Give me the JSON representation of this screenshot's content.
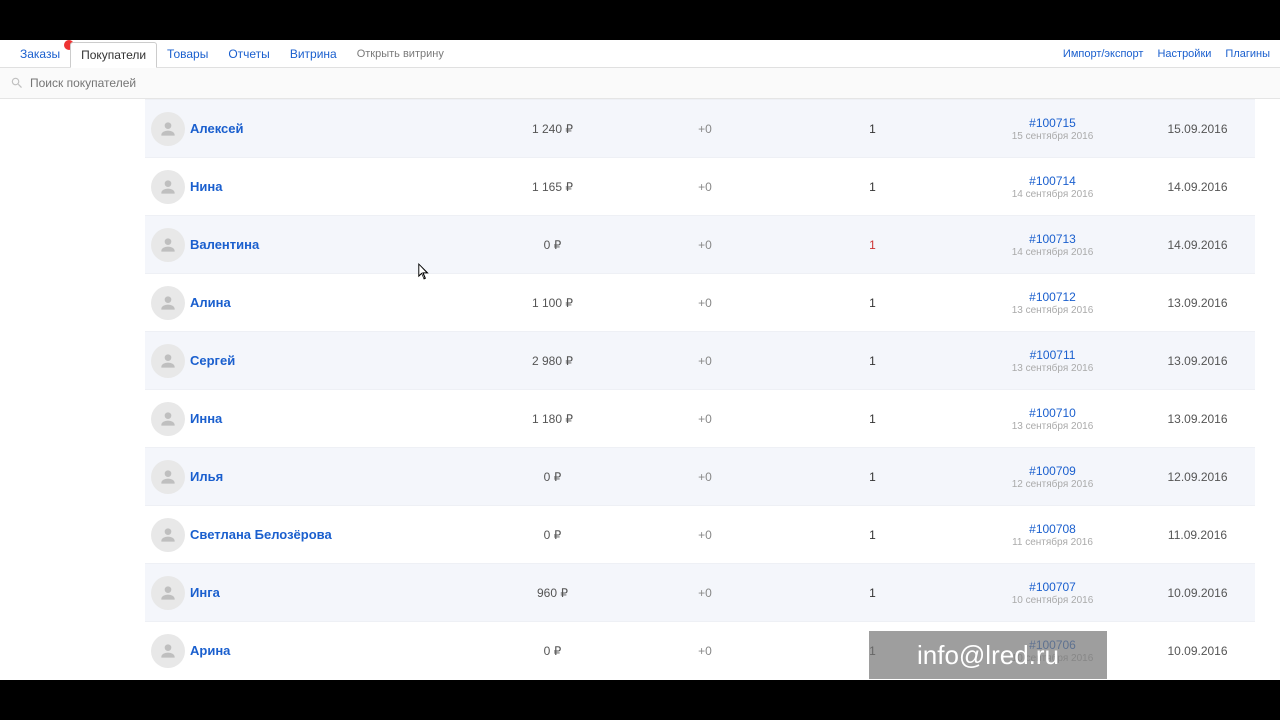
{
  "nav": {
    "tabs": [
      {
        "label": "Заказы"
      },
      {
        "label": "Покупатели"
      },
      {
        "label": "Товары"
      },
      {
        "label": "Отчеты"
      },
      {
        "label": "Витрина"
      }
    ],
    "open_store": "Открыть витрину",
    "right": [
      {
        "label": "Импорт/экспорт"
      },
      {
        "label": "Настройки"
      },
      {
        "label": "Плагины"
      }
    ]
  },
  "search": {
    "placeholder": "Поиск покупателей"
  },
  "customers": [
    {
      "name": "Алексей",
      "amount": "1 240 ₽",
      "plus": "+0",
      "count": "1",
      "count_red": false,
      "order": "#100715",
      "order_date": "15 сентября 2016",
      "date": "15.09.2016"
    },
    {
      "name": "Нина",
      "amount": "1 165 ₽",
      "plus": "+0",
      "count": "1",
      "count_red": false,
      "order": "#100714",
      "order_date": "14 сентября 2016",
      "date": "14.09.2016"
    },
    {
      "name": "Валентина",
      "amount": "0 ₽",
      "plus": "+0",
      "count": "1",
      "count_red": true,
      "order": "#100713",
      "order_date": "14 сентября 2016",
      "date": "14.09.2016"
    },
    {
      "name": "Алина",
      "amount": "1 100 ₽",
      "plus": "+0",
      "count": "1",
      "count_red": false,
      "order": "#100712",
      "order_date": "13 сентября 2016",
      "date": "13.09.2016"
    },
    {
      "name": "Сергей",
      "amount": "2 980 ₽",
      "plus": "+0",
      "count": "1",
      "count_red": false,
      "order": "#100711",
      "order_date": "13 сентября 2016",
      "date": "13.09.2016"
    },
    {
      "name": "Инна",
      "amount": "1 180 ₽",
      "plus": "+0",
      "count": "1",
      "count_red": false,
      "order": "#100710",
      "order_date": "13 сентября 2016",
      "date": "13.09.2016"
    },
    {
      "name": "Илья",
      "amount": "0 ₽",
      "plus": "+0",
      "count": "1",
      "count_red": false,
      "order": "#100709",
      "order_date": "12 сентября 2016",
      "date": "12.09.2016"
    },
    {
      "name": "Светлана Белозёрова",
      "amount": "0 ₽",
      "plus": "+0",
      "count": "1",
      "count_red": false,
      "order": "#100708",
      "order_date": "11 сентября 2016",
      "date": "11.09.2016"
    },
    {
      "name": "Инга",
      "amount": "960 ₽",
      "plus": "+0",
      "count": "1",
      "count_red": false,
      "order": "#100707",
      "order_date": "10 сентября 2016",
      "date": "10.09.2016"
    },
    {
      "name": "Арина",
      "amount": "0 ₽",
      "plus": "+0",
      "count": "1",
      "count_red": false,
      "order": "#100706",
      "order_date": "10 сентября 2016",
      "date": "10.09.2016"
    }
  ],
  "watermark": "info@lred.ru"
}
